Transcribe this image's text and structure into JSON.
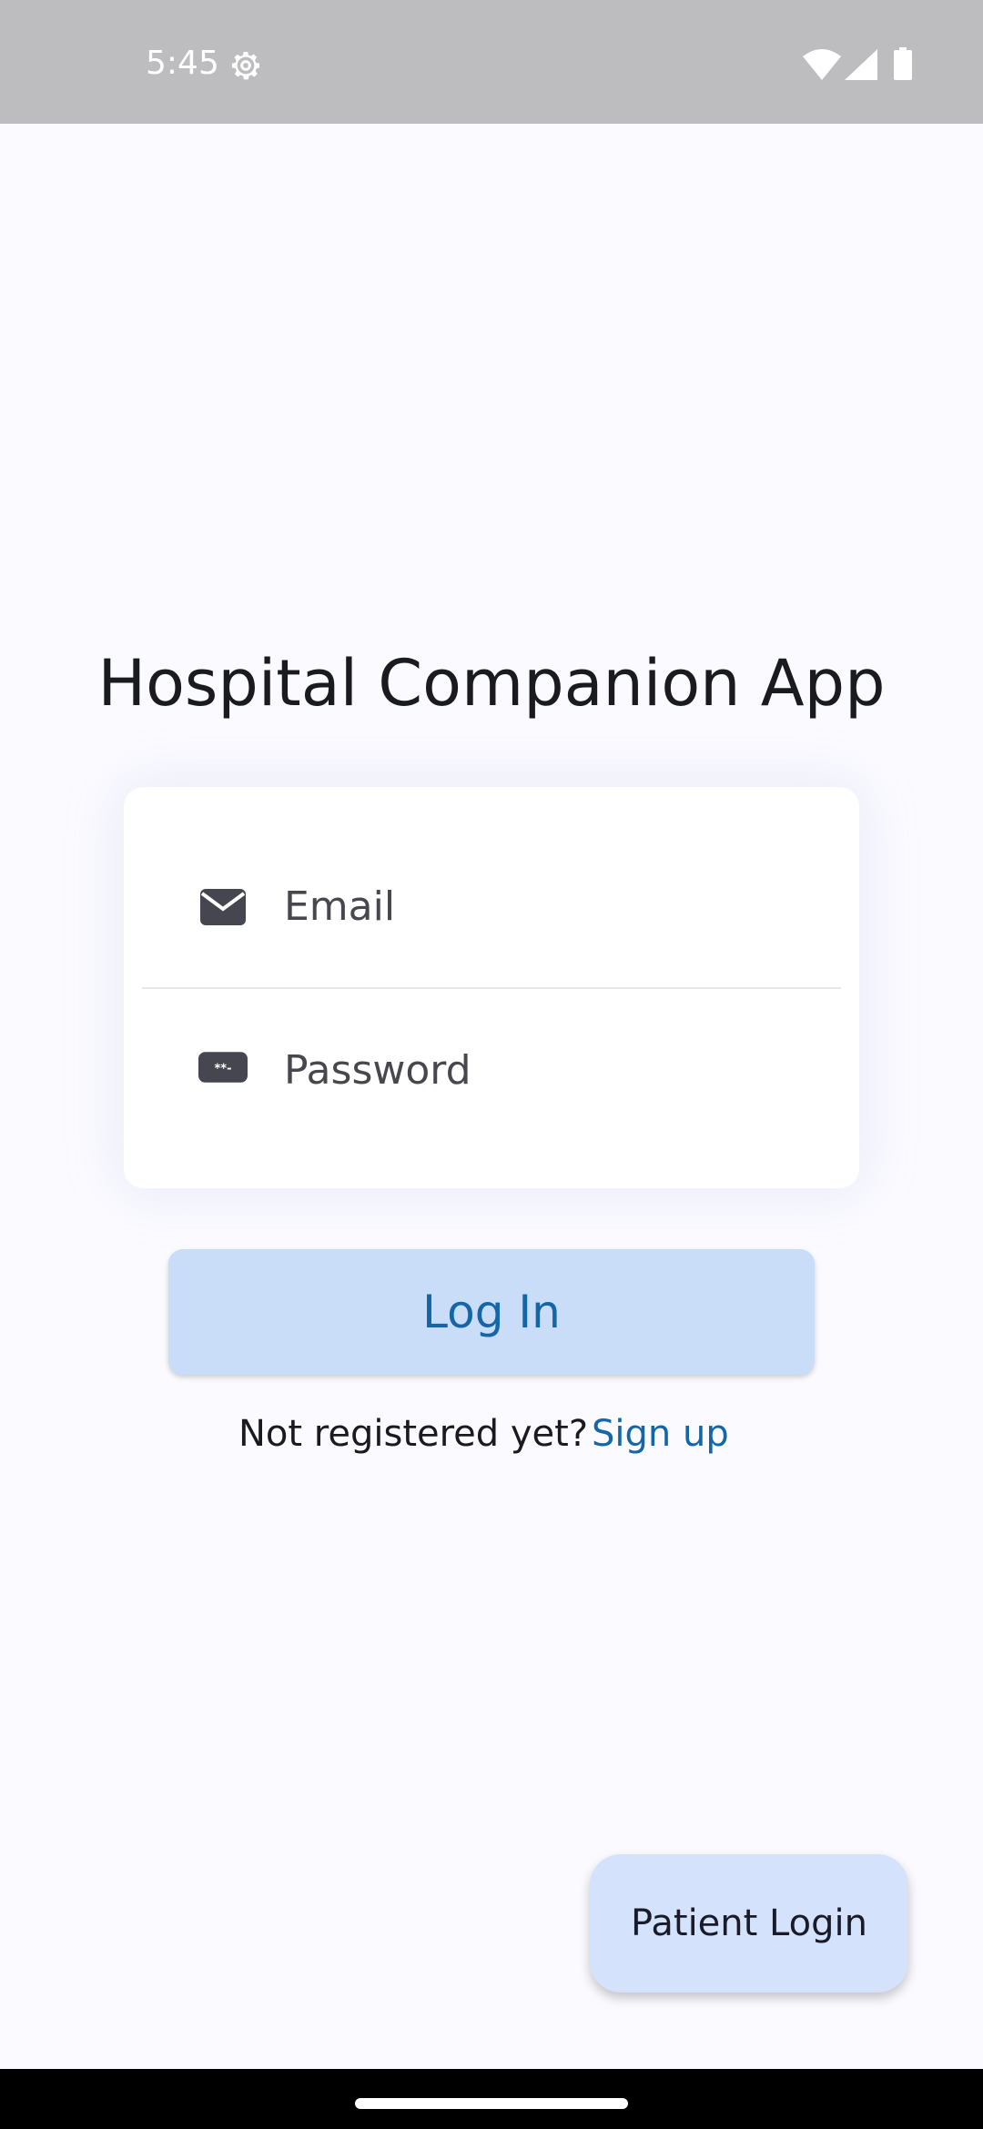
{
  "status_bar": {
    "time": "5:45",
    "icons": [
      "gear-icon",
      "wifi-icon",
      "signal-icon",
      "battery-icon"
    ]
  },
  "app": {
    "title": "Hospital Companion App"
  },
  "form": {
    "email": {
      "value": "",
      "placeholder": "Email",
      "icon": "envelope-icon"
    },
    "password": {
      "value": "",
      "placeholder": "Password",
      "icon": "password-icon"
    }
  },
  "actions": {
    "login_label": "Log In",
    "signup_prompt": "Not registered yet?",
    "signup_link": "Sign up",
    "patient_login_label": "Patient Login"
  },
  "colors": {
    "background": "#fbfbff",
    "status_bar": "#bdbdbf",
    "accent": "#1466a6",
    "login_button_bg": "#c9ddf8",
    "fab_bg": "#d4e3fb"
  }
}
